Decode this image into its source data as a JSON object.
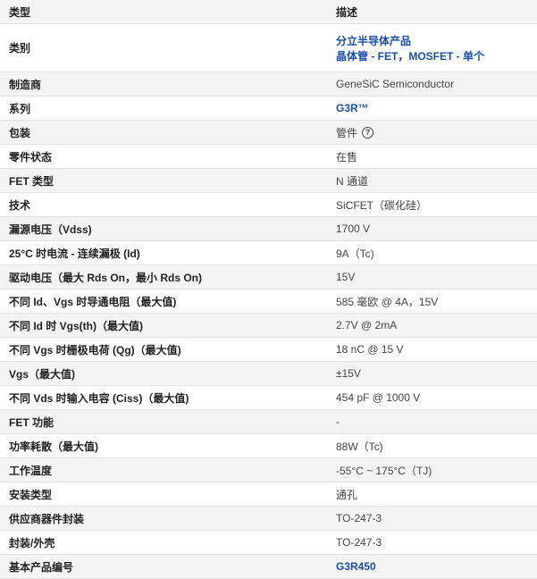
{
  "header": {
    "type_label": "类型",
    "desc_label": "描述"
  },
  "rows": [
    {
      "key": "类别",
      "lines": [
        "分立半导体产品",
        "晶体管 - FET，MOSFET - 单个"
      ],
      "link": true
    },
    {
      "key": "制造商",
      "lines": [
        "GeneSiC Semiconductor"
      ]
    },
    {
      "key": "系列",
      "lines": [
        "G3R™"
      ],
      "link": true
    },
    {
      "key": "包装",
      "lines": [
        "管件"
      ],
      "help": "?"
    },
    {
      "key": "零件状态",
      "lines": [
        "在售"
      ]
    },
    {
      "key": "FET 类型",
      "lines": [
        "N 通道"
      ]
    },
    {
      "key": "技术",
      "lines": [
        "SiCFET（碳化硅）"
      ]
    },
    {
      "key": "漏源电压（Vdss)",
      "lines": [
        "1700 V"
      ]
    },
    {
      "key": "25°C 时电流 - 连续漏极 (Id)",
      "lines": [
        "9A（Tc)"
      ]
    },
    {
      "key": "驱动电压（最大 Rds On，最小 Rds On)",
      "lines": [
        "15V"
      ]
    },
    {
      "key": "不同 Id、Vgs 时导通电阻（最大值)",
      "lines": [
        "585 毫欧 @ 4A，15V"
      ]
    },
    {
      "key": "不同 Id 时 Vgs(th)（最大值)",
      "lines": [
        "2.7V @ 2mA"
      ]
    },
    {
      "key": "不同 Vgs 时栅极电荷 (Qg)（最大值)",
      "lines": [
        "18 nC @ 15 V"
      ]
    },
    {
      "key": "Vgs（最大值)",
      "lines": [
        "±15V"
      ]
    },
    {
      "key": "不同 Vds 时输入电容 (Ciss)（最大值)",
      "lines": [
        "454 pF @ 1000 V"
      ]
    },
    {
      "key": "FET 功能",
      "lines": [
        "-"
      ]
    },
    {
      "key": "功率耗散（最大值)",
      "lines": [
        "88W（Tc)"
      ]
    },
    {
      "key": "工作温度",
      "lines": [
        "-55°C ~ 175°C（TJ)"
      ]
    },
    {
      "key": "安装类型",
      "lines": [
        "通孔"
      ]
    },
    {
      "key": "供应商器件封装",
      "lines": [
        "TO-247-3"
      ]
    },
    {
      "key": "封装/外壳",
      "lines": [
        "TO-247-3"
      ]
    },
    {
      "key": "基本产品编号",
      "lines": [
        "G3R450"
      ],
      "link": true
    }
  ]
}
